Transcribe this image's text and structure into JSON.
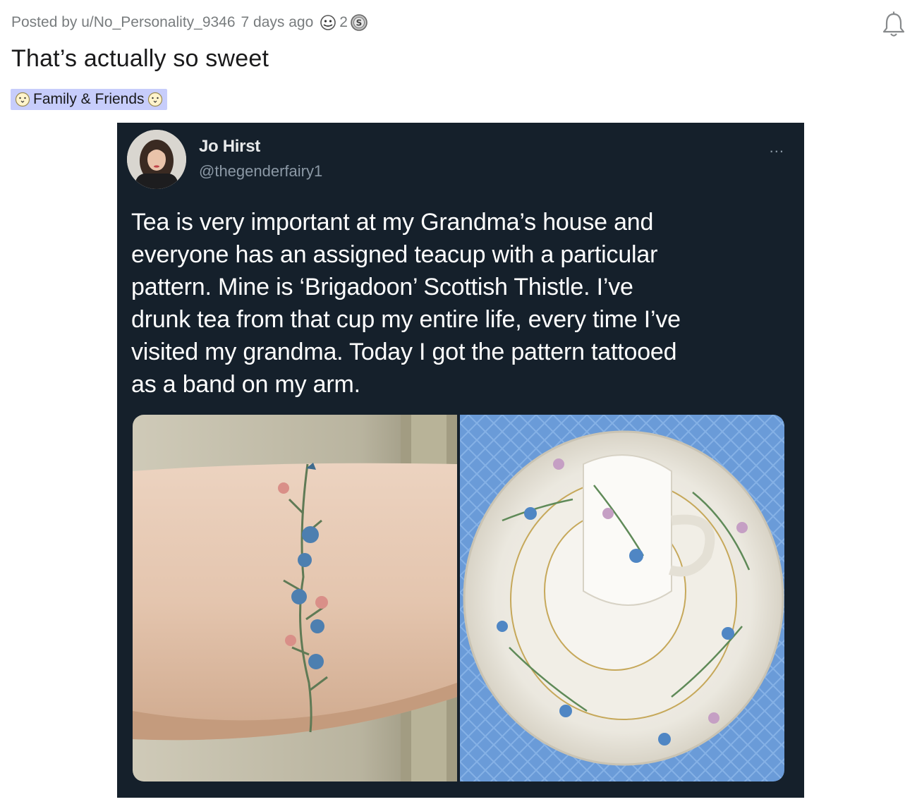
{
  "post": {
    "posted_by": "Posted by u/No_Personality_9346",
    "age": "7 days ago",
    "award_count": "2",
    "title": "That’s actually so sweet",
    "flair": "Family & Friends"
  },
  "icons": {
    "award": "helpful-award-icon",
    "coin": "silver-coin-icon",
    "bell": "bell-icon",
    "flair_emoji": "smiling-face-emoji-icon",
    "more": "more-options-icon"
  },
  "tweet": {
    "name": "Jo Hirst",
    "handle": "@thegenderfairy1",
    "more_label": "...",
    "text": "Tea is very important at my Grandma’s house and\neveryone has an assigned teacup with a particular\npattern. Mine is  ‘Brigadoon’ Scottish Thistle. I’ve\ndrunk tea from that cup my entire life, every time I’ve\nvisited my grandma. Today I got the pattern tattooed\nas a band on my arm."
  },
  "colors": {
    "page_bg": "#ffffff",
    "meta_text": "#787c7e",
    "title_text": "#1a1a1b",
    "flair_bg": "#c7cdfb",
    "tweet_bg": "#15202b",
    "tweet_text": "#ffffff",
    "handle_text": "#8b98a5"
  }
}
